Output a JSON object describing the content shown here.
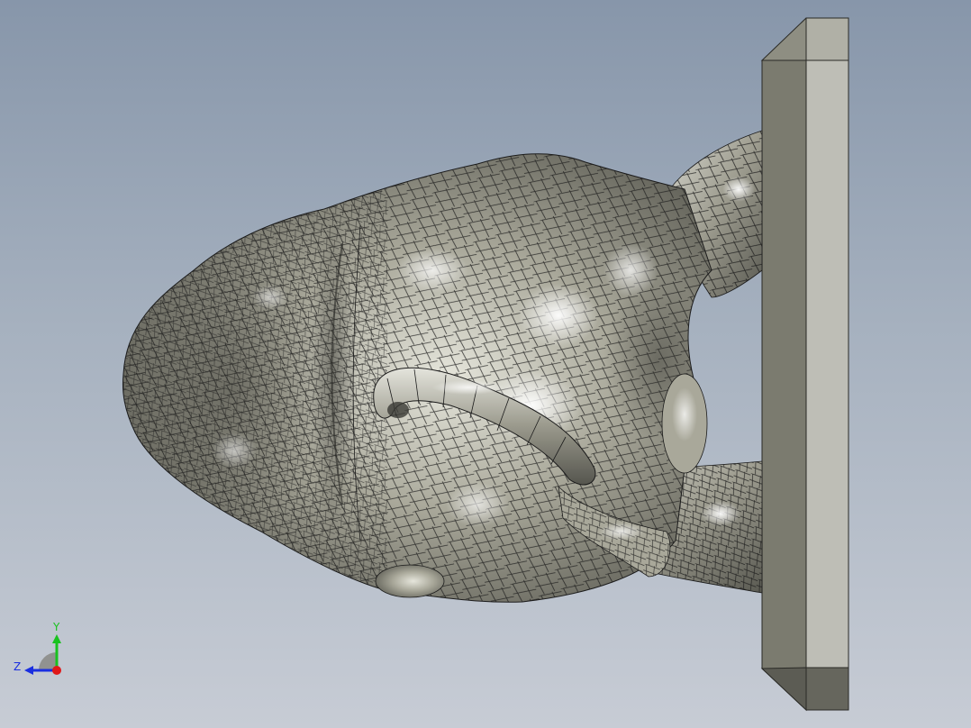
{
  "viewport": {
    "model": "sculpted-head-on-base-plate",
    "colors": {
      "background_top": "#8796aa",
      "background_bottom": "#c7ccd5",
      "mesh_surface": "#a9a89a",
      "mesh_highlight": "#f2f2ea",
      "mesh_shadow": "#4a4a44",
      "edge_lines": "#1b1b1b",
      "plate_face": "#bebeb6",
      "plate_side": "#7b7b6f",
      "plate_end": "#66665d"
    }
  },
  "triad": {
    "y_label": "Y",
    "z_label": "Z",
    "y_color": "#19c21f",
    "z_color": "#1a2ee0",
    "x_color": "#e01818"
  }
}
